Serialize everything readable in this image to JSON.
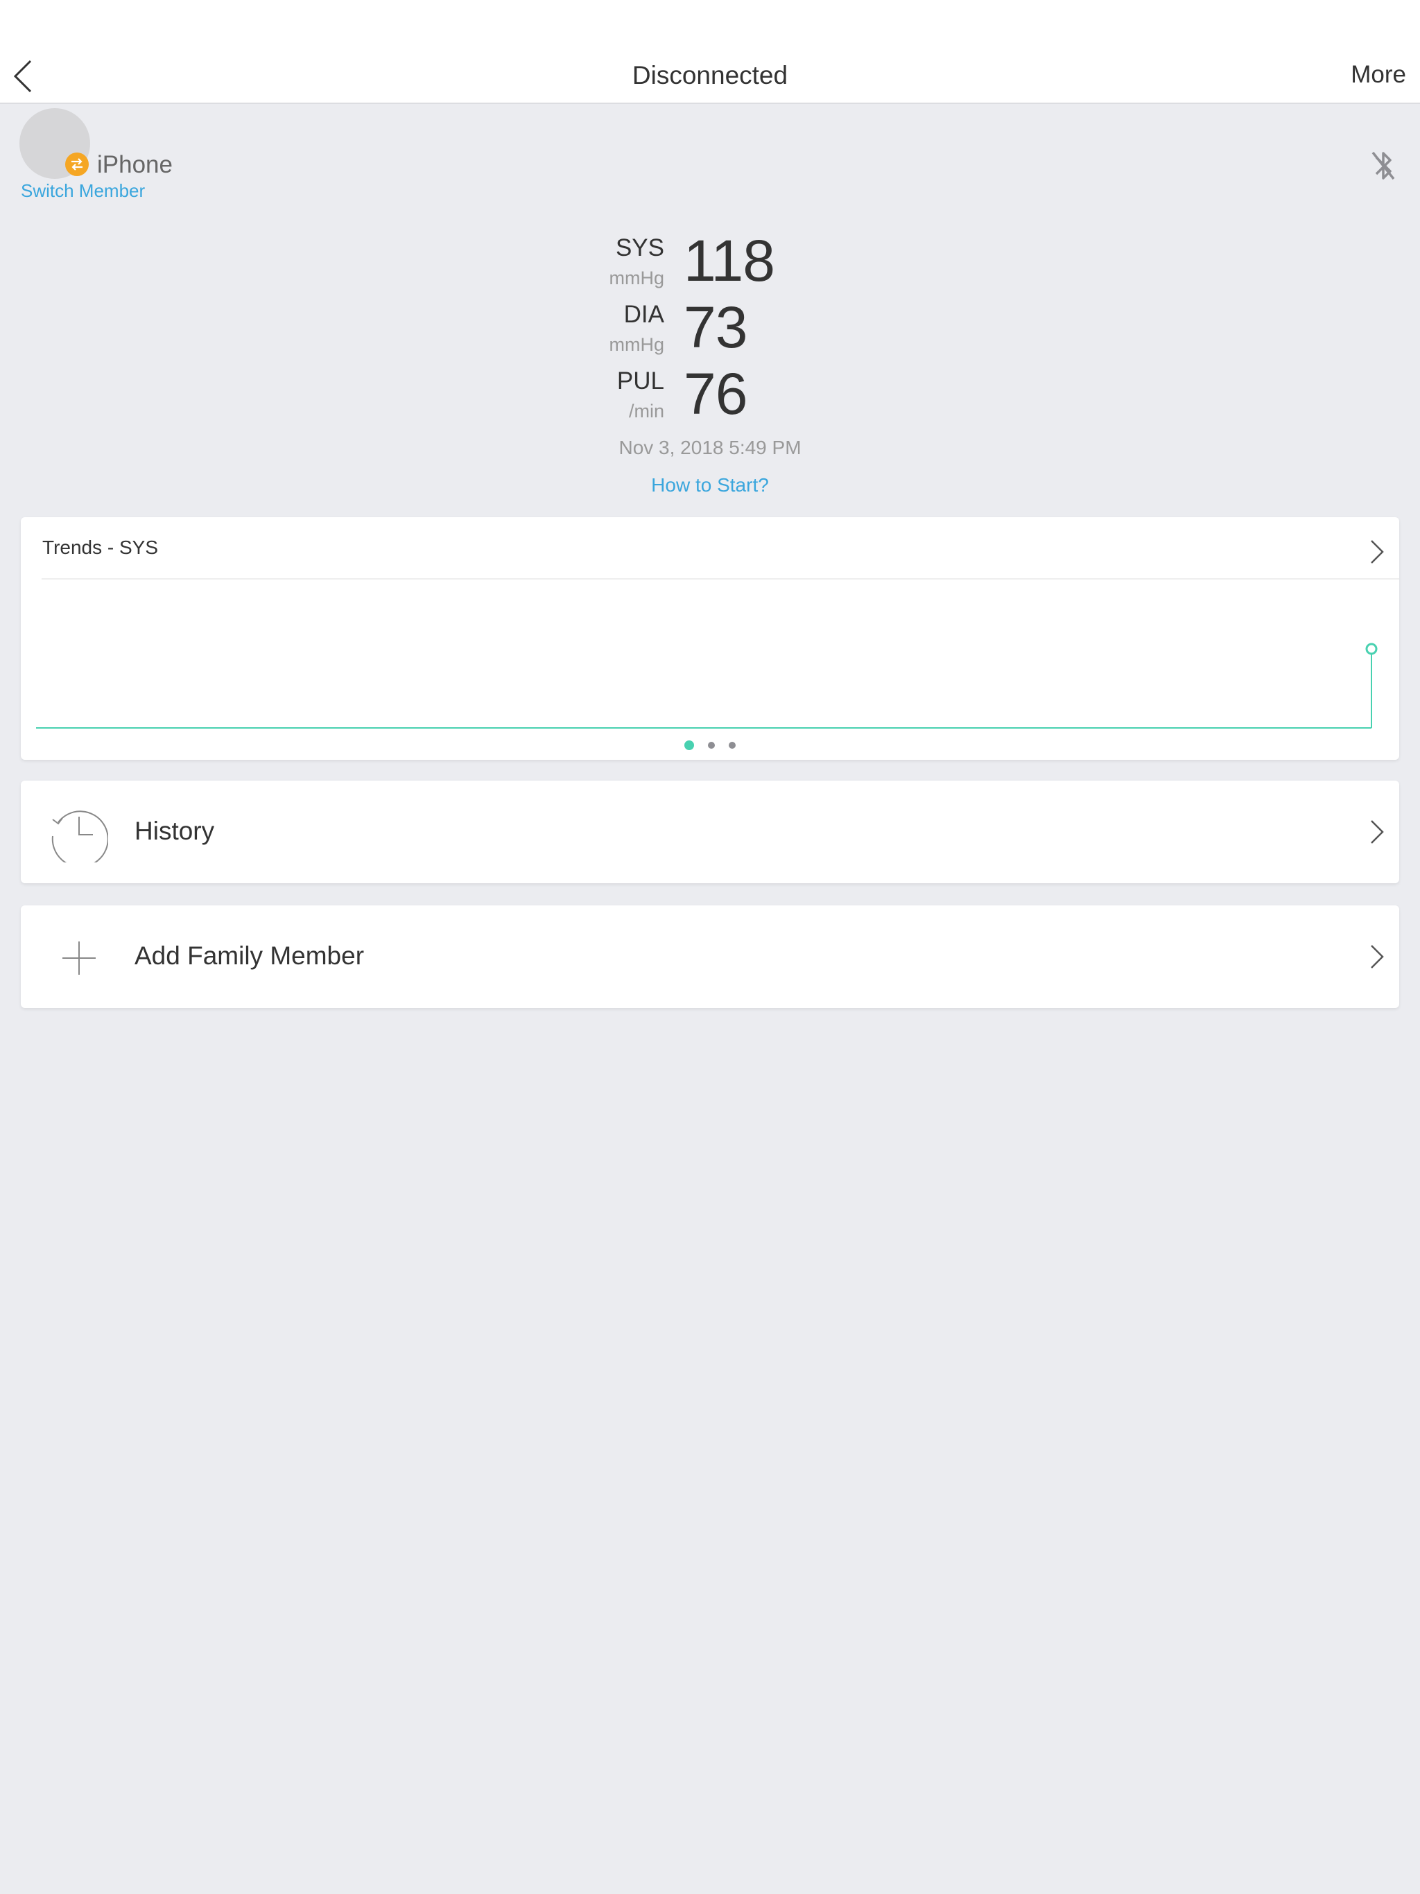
{
  "navbar": {
    "title": "Disconnected",
    "more_label": "More"
  },
  "member": {
    "name": "iPhone",
    "switch_label": "Switch Member"
  },
  "readings": [
    {
      "label": "SYS",
      "unit": "mmHg",
      "value": "118"
    },
    {
      "label": "DIA",
      "unit": "mmHg",
      "value": "73"
    },
    {
      "label": "PUL",
      "unit": "/min",
      "value": "76"
    }
  ],
  "timestamp": "Nov 3, 2018 5:49 PM",
  "how_to_start": "How to Start?",
  "trends": {
    "title": "Trends - SYS",
    "pages": 3,
    "active_page": 0,
    "line_color": "#48d1b0"
  },
  "menu": {
    "history_label": "History",
    "add_family_label": "Add Family Member"
  },
  "colors": {
    "accent_blue": "#3aa6dd",
    "accent_teal": "#48d1b0",
    "badge_orange": "#f5a623",
    "background": "#ebecf0"
  },
  "icons": {
    "back": "chevron-left-icon",
    "bluetooth": "bluetooth-disabled-icon",
    "history": "history-clock-icon",
    "add": "plus-icon",
    "switch": "swap-arrows-icon"
  }
}
